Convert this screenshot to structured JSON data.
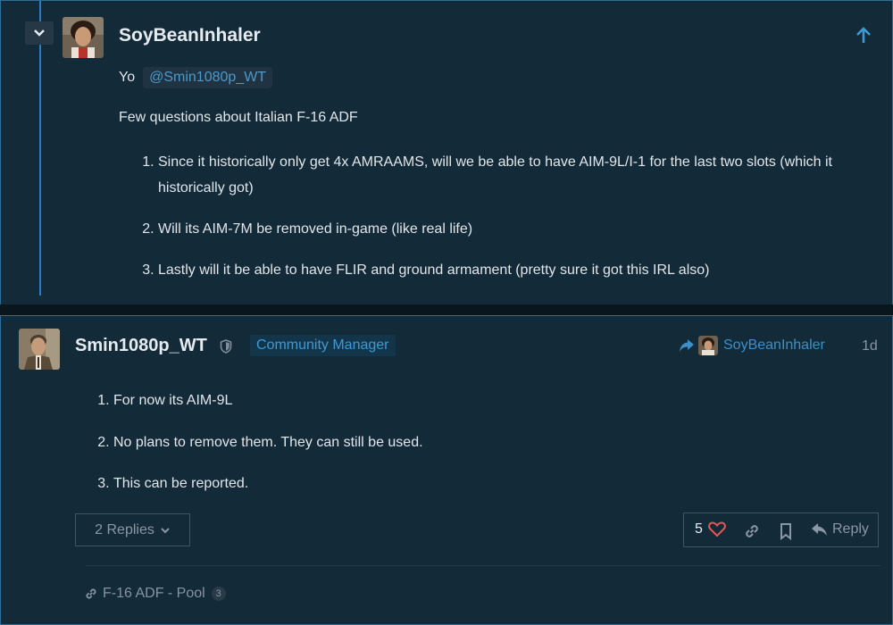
{
  "quote": {
    "username": "SoyBeanInhaler",
    "greeting": "Yo",
    "mention": "@Smin1080p_WT",
    "intro": "Few questions about Italian F-16 ADF",
    "items": [
      "Since it historically only get 4x AMRAAMS, will we be able to have AIM-9L/I-1 for the last two slots (which it historically got)",
      "Will its AIM-7M be removed in-game (like real life)",
      "Lastly will it be able to have FLIR and ground armament (pretty sure it got this IRL also)"
    ],
    "icons": {
      "collapse": "chevron-down-icon",
      "jump": "arrow-up-icon"
    }
  },
  "post": {
    "username": "Smin1080p_WT",
    "flair": "Community Manager",
    "reply_to": "SoyBeanInhaler",
    "date": "1d",
    "items": [
      "For now its AIM-9L",
      "No plans to remove them. They can still be used.",
      "This can be reported."
    ],
    "replies_label": "2 Replies",
    "likes": "5",
    "reply_label": "Reply",
    "link_text": "F-16 ADF - Pool",
    "link_count": "3"
  },
  "colors": {
    "accent": "#3d9ad6",
    "panel": "#132a38",
    "border": "#2e6e97",
    "heart": "#e45755"
  }
}
